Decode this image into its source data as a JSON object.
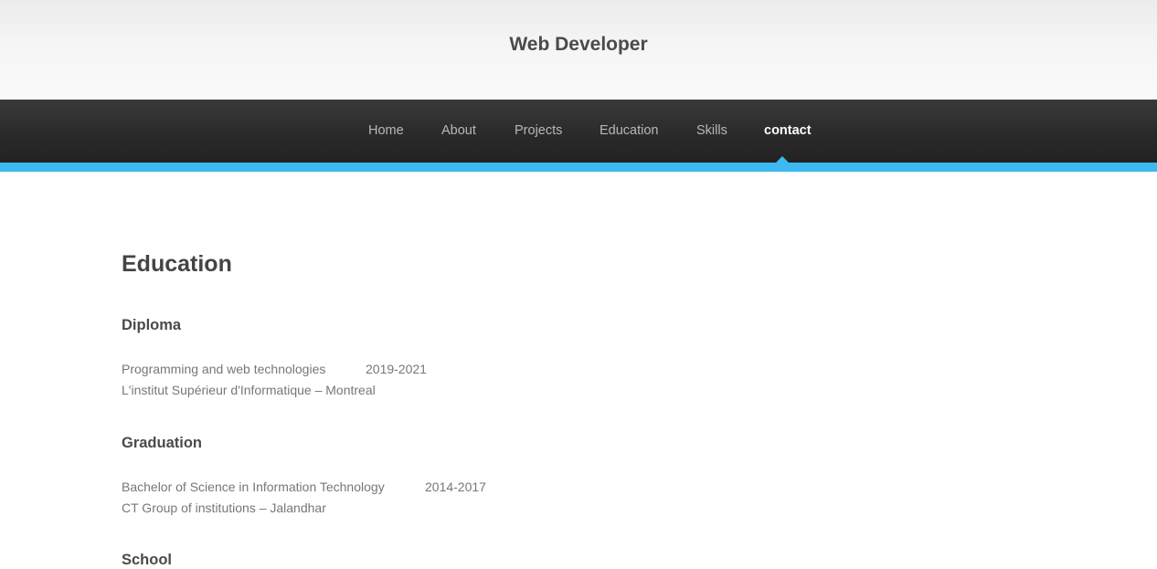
{
  "header": {
    "site_title": "Web Developer"
  },
  "nav": {
    "items": [
      {
        "label": "Home"
      },
      {
        "label": "About"
      },
      {
        "label": "Projects"
      },
      {
        "label": "Education"
      },
      {
        "label": "Skills"
      },
      {
        "label": "contact"
      }
    ],
    "active_item": "contact"
  },
  "colors": {
    "accent": "#3bb9f0",
    "navbar": "#2b2b2b",
    "heading_text": "#444444",
    "body_text": "#777777"
  },
  "main": {
    "section_title": "Education",
    "entries": [
      {
        "title": "Diploma",
        "program": "Programming and web technologies",
        "years": "2019-2021",
        "institution": "L'institut Supérieur d'Informatique – Montreal"
      },
      {
        "title": "Graduation",
        "program": "Bachelor of Science in Information Technology",
        "years": "2014-2017",
        "institution": "CT Group of institutions – Jalandhar"
      },
      {
        "title": "School"
      }
    ]
  }
}
